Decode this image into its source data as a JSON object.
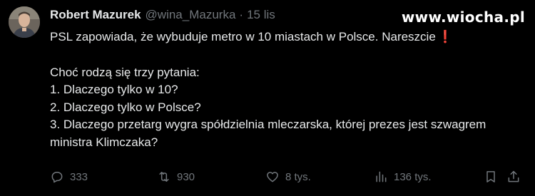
{
  "author": {
    "name": "Robert Mazurek",
    "handle": "@wina_Mazurka",
    "separator": "·",
    "time": "15 lis"
  },
  "watermark": "www.wiocha.pl",
  "tweet": {
    "line1": "PSL zapowiada, że wybuduje metro w 10 miastach w Polsce. Nareszcie",
    "line1_emoji": "❗",
    "question_intro": "Choć rodzą się trzy pytania:",
    "q1": "1. Dlaczego tylko w 10?",
    "q2": "2. Dlaczego tylko w Polsce?",
    "q3": "3. Dlaczego przetarg wygra spółdzielnia mleczarska, której prezes jest szwagrem ministra Klimczaka?"
  },
  "actions": {
    "replies": "333",
    "retweets": "930",
    "likes": "8 tys.",
    "views": "136 tys."
  },
  "icons": {
    "reply": "reply-icon",
    "retweet": "retweet-icon",
    "like": "heart-icon",
    "views": "views-chart-icon",
    "bookmark": "bookmark-icon",
    "share": "share-icon"
  },
  "colors": {
    "background": "#000000",
    "text": "#e7e9ea",
    "muted": "#71767b",
    "accent_red": "#e0243a"
  }
}
